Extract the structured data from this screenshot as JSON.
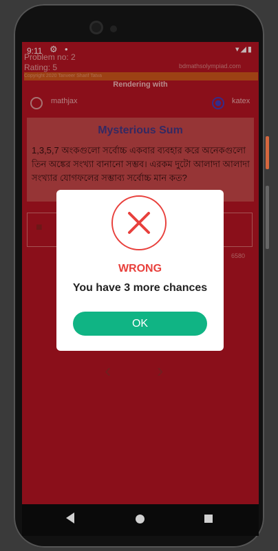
{
  "statusbar": {
    "time": "9:11",
    "settings_icon": "gear-icon",
    "dot": "•",
    "right_icons": "▾◢▮"
  },
  "background": {
    "meta1": "Problem no: 2",
    "meta2": "Rating: 5",
    "meta_right": "bdmathsolympiad.com",
    "copyright": "Copyright 2020 Tanveer Sharif Tatva",
    "rendering_with": "Rendering with",
    "radio_options": [
      "mathjax",
      "katex"
    ],
    "problem_title": "Mysterious Sum",
    "problem_text": "1,3,5,7 অংকগুলো সর্বোচ্চ একবার ব্যবহার করে অনেকগুলো তিন অঙ্কের সংখ্যা বানানো সম্ভব। এরকম দুটো আলাদা আলাদা সংখ্যার যোগফলের সম্ভাব্য সর্বোচ্চ মান কত?",
    "small_right": "6580",
    "prev_arrow": "‹",
    "next_arrow": "›"
  },
  "dialog": {
    "title": "WRONG",
    "message": "You have 3 more chances",
    "ok_label": "OK",
    "accent_color": "#e8403c",
    "button_color": "#10b484"
  }
}
